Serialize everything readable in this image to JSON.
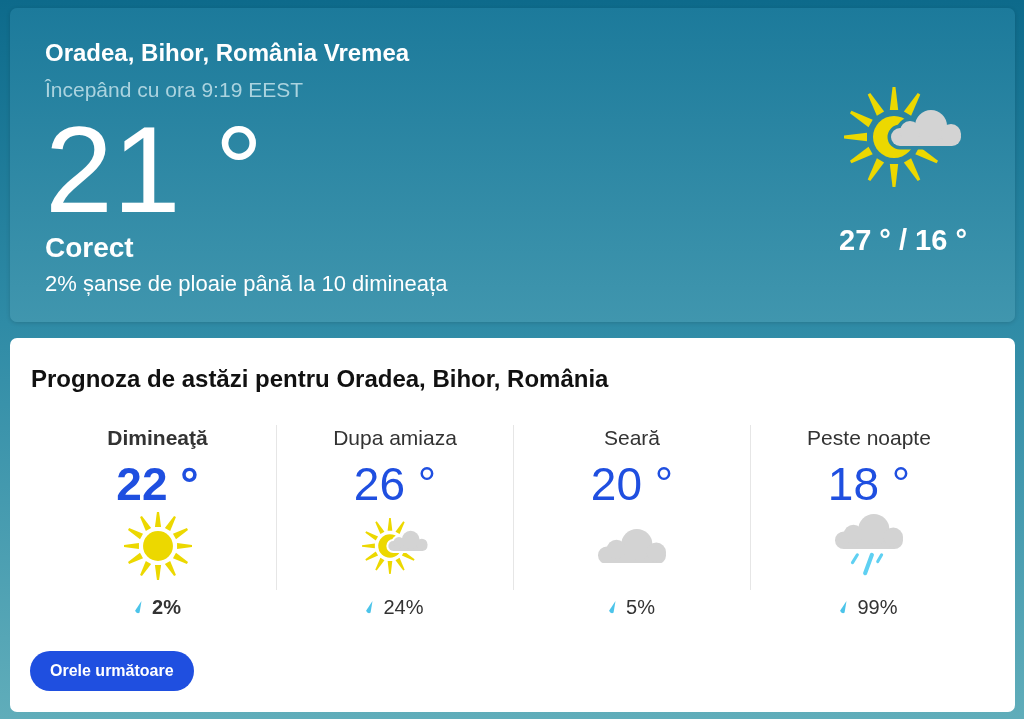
{
  "current": {
    "title": "Oradea, Bihor, România Vremea",
    "updated": "Începând cu ora 9:19 EEST",
    "temperature": "21 °",
    "condition": "Corect",
    "rain_note": "2% șanse de ploaie până la 10 dimineața",
    "kind": "partly-cloudy",
    "high_low": "27 ° / 16 °"
  },
  "forecast": {
    "title": "Prognoza de astăzi pentru Oradea, Bihor, România",
    "periods": [
      {
        "label": "Dimineaţă",
        "temperature": "22 °",
        "kind": "sunny",
        "rain": "2%",
        "selected": true
      },
      {
        "label": "Dupa amiaza",
        "temperature": "26 °",
        "kind": "partly-cloudy",
        "rain": "24%",
        "selected": false
      },
      {
        "label": "Seară",
        "temperature": "20 °",
        "kind": "cloudy",
        "rain": "5%",
        "selected": false
      },
      {
        "label": "Peste noapte",
        "temperature": "18 °",
        "kind": "rain",
        "rain": "99%",
        "selected": false
      }
    ],
    "button": "Orele următoare"
  }
}
